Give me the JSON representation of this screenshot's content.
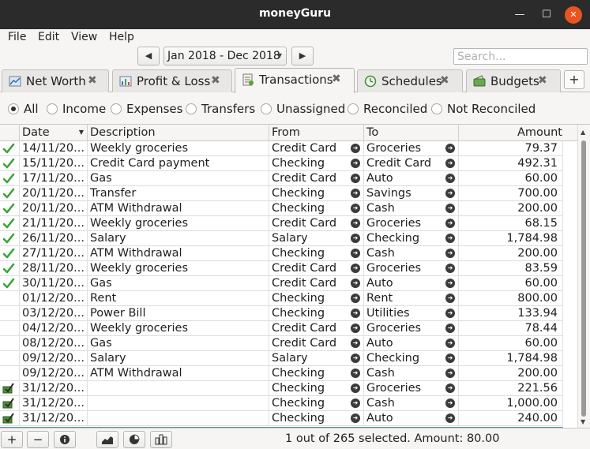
{
  "window": {
    "title": "moneyGuru"
  },
  "menu": [
    "File",
    "Edit",
    "View",
    "Help"
  ],
  "date_range": {
    "label": "Jan 2018 - Dec 2018"
  },
  "search": {
    "placeholder": "Search..."
  },
  "tabs": [
    {
      "label": "Net Worth",
      "icon": "net-worth-chart-icon",
      "active": false
    },
    {
      "label": "Profit & Loss",
      "icon": "profit-loss-chart-icon",
      "active": false
    },
    {
      "label": "Transactions",
      "icon": "transactions-ledger-icon",
      "active": true
    },
    {
      "label": "Schedules",
      "icon": "schedules-clock-icon",
      "active": false
    },
    {
      "label": "Budgets",
      "icon": "budgets-wallet-icon",
      "active": false
    }
  ],
  "filters": [
    {
      "label": "All",
      "checked": true
    },
    {
      "label": "Income",
      "checked": false
    },
    {
      "label": "Expenses",
      "checked": false
    },
    {
      "label": "Transfers",
      "checked": false
    },
    {
      "label": "Unassigned",
      "checked": false
    },
    {
      "label": "Reconciled",
      "checked": false
    },
    {
      "label": "Not Reconciled",
      "checked": false
    }
  ],
  "table": {
    "headers": {
      "date": "Date",
      "description": "Description",
      "from": "From",
      "to": "To",
      "amount": "Amount"
    },
    "rows": [
      {
        "status": "reconciled",
        "date": "14/11/20...",
        "description": "Weekly groceries",
        "from": "Credit Card",
        "to": "Groceries",
        "amount": "79.37"
      },
      {
        "status": "reconciled",
        "date": "15/11/20...",
        "description": "Credit Card payment",
        "from": "Checking",
        "to": "Credit Card",
        "amount": "492.31"
      },
      {
        "status": "reconciled",
        "date": "17/11/20...",
        "description": "Gas",
        "from": "Credit Card",
        "to": "Auto",
        "amount": "60.00"
      },
      {
        "status": "reconciled",
        "date": "20/11/20...",
        "description": "Transfer",
        "from": "Checking",
        "to": "Savings",
        "amount": "700.00"
      },
      {
        "status": "reconciled",
        "date": "20/11/20...",
        "description": "ATM Withdrawal",
        "from": "Checking",
        "to": "Cash",
        "amount": "200.00"
      },
      {
        "status": "reconciled",
        "date": "21/11/20...",
        "description": "Weekly groceries",
        "from": "Credit Card",
        "to": "Groceries",
        "amount": "68.15"
      },
      {
        "status": "reconciled",
        "date": "26/11/20...",
        "description": "Salary",
        "from": "Salary",
        "to": "Checking",
        "amount": "1,784.98"
      },
      {
        "status": "reconciled",
        "date": "27/11/20...",
        "description": "ATM Withdrawal",
        "from": "Checking",
        "to": "Cash",
        "amount": "200.00"
      },
      {
        "status": "reconciled",
        "date": "28/11/20...",
        "description": "Weekly groceries",
        "from": "Credit Card",
        "to": "Groceries",
        "amount": "83.59"
      },
      {
        "status": "reconciled",
        "date": "30/11/20...",
        "description": "Gas",
        "from": "Credit Card",
        "to": "Auto",
        "amount": "60.00"
      },
      {
        "status": "",
        "date": "01/12/20...",
        "description": "Rent",
        "from": "Checking",
        "to": "Rent",
        "amount": "800.00"
      },
      {
        "status": "",
        "date": "03/12/20...",
        "description": "Power Bill",
        "from": "Checking",
        "to": "Utilities",
        "amount": "133.94"
      },
      {
        "status": "",
        "date": "04/12/20...",
        "description": "Weekly groceries",
        "from": "Credit Card",
        "to": "Groceries",
        "amount": "78.44"
      },
      {
        "status": "",
        "date": "08/12/20...",
        "description": "Gas",
        "from": "Credit Card",
        "to": "Auto",
        "amount": "60.00"
      },
      {
        "status": "",
        "date": "09/12/20...",
        "description": "Salary",
        "from": "Salary",
        "to": "Checking",
        "amount": "1,784.98"
      },
      {
        "status": "",
        "date": "09/12/20...",
        "description": "ATM Withdrawal",
        "from": "Checking",
        "to": "Cash",
        "amount": "200.00"
      },
      {
        "status": "scheduled",
        "date": "31/12/20...",
        "description": "",
        "from": "Checking",
        "to": "Groceries",
        "amount": "221.56"
      },
      {
        "status": "scheduled",
        "date": "31/12/20...",
        "description": "",
        "from": "Checking",
        "to": "Cash",
        "amount": "1,000.00"
      },
      {
        "status": "scheduled",
        "date": "31/12/20...",
        "description": "",
        "from": "Checking",
        "to": "Auto",
        "amount": "240.00"
      }
    ]
  },
  "status_bar": {
    "text": "1 out of 265 selected. Amount: 80.00"
  },
  "colors": {
    "title_bar": "#2b2b2b",
    "close_button": "#e95420",
    "selection": "#4a90d9",
    "reconciled_check": "#3aa535"
  }
}
